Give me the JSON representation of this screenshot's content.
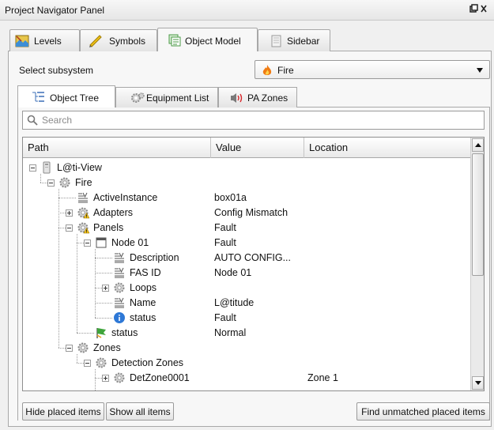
{
  "window": {
    "title": "Project Navigator Panel",
    "float_glyph": "❐",
    "close_glyph": "×"
  },
  "top_tabs": [
    {
      "label": "Levels",
      "icon": "levels-map-icon",
      "active": false
    },
    {
      "label": "Symbols",
      "icon": "symbols-icon",
      "active": false
    },
    {
      "label": "Object Model",
      "icon": "object-model-icon",
      "active": true
    },
    {
      "label": "Sidebar",
      "icon": "sidebar-icon",
      "active": false
    }
  ],
  "subsystem": {
    "label": "Select subsystem",
    "value": "Fire",
    "icon": "flame-icon"
  },
  "inner_tabs": [
    {
      "label": "Object Tree",
      "icon": "tree-list-icon",
      "active": true
    },
    {
      "label": "Equipment List",
      "icon": "gears-icon",
      "active": false
    },
    {
      "label": "PA Zones",
      "icon": "speaker-icon",
      "active": false
    }
  ],
  "search": {
    "placeholder": "Search",
    "value": ""
  },
  "tree": {
    "columns": [
      "Path",
      "Value",
      "Location"
    ],
    "rows": [
      {
        "name": "L@ti-View",
        "value": "",
        "location": "",
        "level": 0,
        "toggle": "minus",
        "icon": "server-icon"
      },
      {
        "name": "Fire",
        "value": "",
        "location": "",
        "level": 1,
        "toggle": "minus",
        "icon": "gear-icon"
      },
      {
        "name": "ActiveInstance",
        "value": "box01a",
        "location": "",
        "level": 2,
        "toggle": "none",
        "icon": "property-icon"
      },
      {
        "name": "Adapters",
        "value": "Config Mismatch",
        "location": "",
        "level": 2,
        "toggle": "plus",
        "icon": "gear-warning-icon"
      },
      {
        "name": "Panels",
        "value": "Fault",
        "location": "",
        "level": 2,
        "toggle": "minus",
        "icon": "gear-warning-icon"
      },
      {
        "name": "Node 01",
        "value": "Fault",
        "location": "",
        "level": 3,
        "toggle": "minus",
        "icon": "panel-icon"
      },
      {
        "name": "Description",
        "value": "AUTO CONFIG...",
        "location": "",
        "level": 4,
        "toggle": "none",
        "icon": "property-icon"
      },
      {
        "name": "FAS ID",
        "value": "Node 01",
        "location": "",
        "level": 4,
        "toggle": "none",
        "icon": "property-icon"
      },
      {
        "name": "Loops",
        "value": "",
        "location": "",
        "level": 4,
        "toggle": "plus",
        "icon": "gear-icon"
      },
      {
        "name": "Name",
        "value": "L@titude",
        "location": "",
        "level": 4,
        "toggle": "none",
        "icon": "property-icon"
      },
      {
        "name": "status",
        "value": "Fault",
        "location": "",
        "level": 4,
        "toggle": "none",
        "icon": "info-icon"
      },
      {
        "name": "status",
        "value": "Normal",
        "location": "",
        "level": 3,
        "toggle": "none",
        "icon": "status-flag-icon"
      },
      {
        "name": "Zones",
        "value": "",
        "location": "",
        "level": 2,
        "toggle": "minus",
        "icon": "gear-icon"
      },
      {
        "name": "Detection Zones",
        "value": "",
        "location": "",
        "level": 3,
        "toggle": "minus",
        "icon": "gear-icon"
      },
      {
        "name": "DetZone0001",
        "value": "",
        "location": "Zone 1",
        "level": 4,
        "toggle": "plus",
        "icon": "gear-icon"
      }
    ]
  },
  "buttons": {
    "hide_placed": "Hide placed items",
    "show_all": "Show all items",
    "find_unmatched": "Find unmatched placed items"
  },
  "colors": {
    "accent_fire": "#f07b12",
    "warning": "#f2c21b",
    "info": "#2e78d6",
    "status_green": "#3ea43b"
  }
}
